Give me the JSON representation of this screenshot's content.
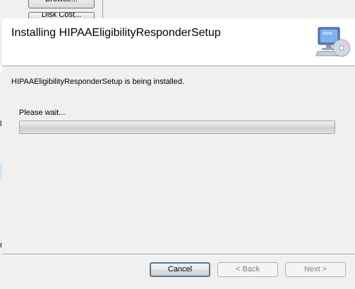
{
  "background_window": {
    "button1_label": "Browse...",
    "button2_label": "Disk Cost...",
    "edge_glyph1": "l",
    "edge_glyph2": "n"
  },
  "dialog": {
    "title": "Installing HIPAAEligibilityResponderSetup",
    "header_icon": "computer-with-cd-icon",
    "status_message": "HIPAAEligibilityResponderSetup is being installed.",
    "wait_label": "Please wait...",
    "progress_fraction": 0,
    "buttons": {
      "cancel": "Cancel",
      "back": "< Back",
      "next": "Next >"
    }
  },
  "colors": {
    "header_bg": "#ffffff",
    "dialog_bg": "#f0f0f0",
    "disabled_text": "#838383"
  }
}
